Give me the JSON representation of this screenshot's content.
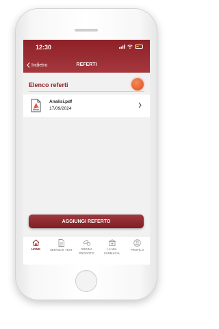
{
  "status_bar": {
    "time": "12:30"
  },
  "header": {
    "back_label": "Indietro",
    "title": "REFERTI"
  },
  "list": {
    "title": "Elenco referti",
    "items": [
      {
        "name": "Analisi.pdf",
        "date": "17/09/2024"
      }
    ]
  },
  "actions": {
    "add_label": "AGGIUNGI REFERTO"
  },
  "tabbar": {
    "items": [
      {
        "label": "HOME",
        "active": true
      },
      {
        "label": "SERVIZI E TEST",
        "active": false
      },
      {
        "label": "ORDINA PRODOTTI",
        "active": false
      },
      {
        "label": "LA MIA FARMACIA",
        "active": false
      },
      {
        "label": "PROFILO",
        "active": false
      }
    ]
  },
  "colors": {
    "brand": "#8e2027",
    "accent_dot": "#e95f2f",
    "battery": "#e69a2c",
    "inactive_tab": "#9a9a9a"
  },
  "icons": {
    "back": "chevron-left-icon",
    "file": "pdf-file-icon",
    "list_item": "chevron-right-icon",
    "tabs": [
      "home-icon",
      "document-icon",
      "pills-icon",
      "pharmacy-icon",
      "user-icon"
    ]
  }
}
